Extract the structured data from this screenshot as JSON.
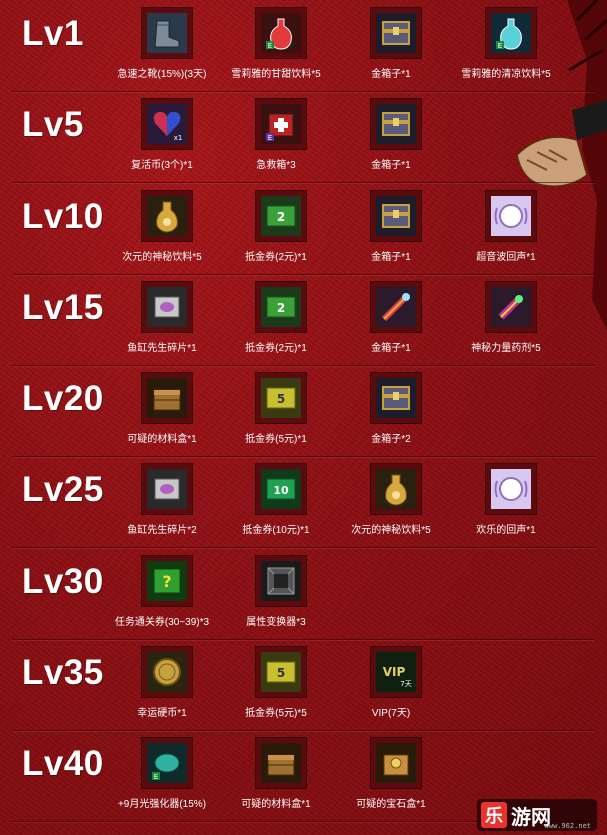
{
  "colors": {
    "background": "#8e1014",
    "icon_frame": "#5b0b0d",
    "text": "#ffffff",
    "logo_red": "#e8322c"
  },
  "rows": [
    {
      "level": "Lv1",
      "items": [
        {
          "label": "急速之靴(15%)(3天)",
          "icon": "boots-icon"
        },
        {
          "label": "雪莉雅的甘甜饮料*5",
          "icon": "red-potion-icon"
        },
        {
          "label": "金箱子*1",
          "icon": "gold-box-icon"
        },
        {
          "label": "雪莉雅的清凉饮料*5",
          "icon": "blue-potion-icon"
        }
      ]
    },
    {
      "level": "Lv5",
      "items": [
        {
          "label": "复活币(3个)*1",
          "icon": "revive-coin-icon"
        },
        {
          "label": "急救箱*3",
          "icon": "first-aid-kit-icon"
        },
        {
          "label": "金箱子*1",
          "icon": "gold-box-icon"
        }
      ]
    },
    {
      "level": "Lv10",
      "items": [
        {
          "label": "次元的神秘饮料*5",
          "icon": "mystic-drink-icon"
        },
        {
          "label": "抵金券(2元)*1",
          "icon": "coupon-2-icon"
        },
        {
          "label": "金箱子*1",
          "icon": "gold-box-icon"
        },
        {
          "label": "超音波回声*1",
          "icon": "echo-icon"
        }
      ]
    },
    {
      "level": "Lv15",
      "items": [
        {
          "label": "鱼缸先生碎片*1",
          "icon": "fish-tank-shard-icon"
        },
        {
          "label": "抵金券(2元)*1",
          "icon": "coupon-2-icon"
        },
        {
          "label": "金箱子*1",
          "icon": "crystal-wand-icon"
        },
        {
          "label": "神秘力量药剂*5",
          "icon": "power-potion-icon"
        }
      ]
    },
    {
      "level": "Lv20",
      "items": [
        {
          "label": "可疑的材料盒*1",
          "icon": "material-box-icon"
        },
        {
          "label": "抵金券(5元)*1",
          "icon": "coupon-5-icon"
        },
        {
          "label": "金箱子*2",
          "icon": "gold-box-icon"
        }
      ]
    },
    {
      "level": "Lv25",
      "items": [
        {
          "label": "鱼缸先生碎片*2",
          "icon": "fish-tank-shard-icon"
        },
        {
          "label": "抵金券(10元)*1",
          "icon": "coupon-10-icon"
        },
        {
          "label": "次元的神秘饮料*5",
          "icon": "mystic-drink-icon"
        },
        {
          "label": "欢乐的回声*1",
          "icon": "echo-icon"
        }
      ]
    },
    {
      "level": "Lv30",
      "items": [
        {
          "label": "任务通关券(30~39)*3",
          "icon": "quest-ticket-icon"
        },
        {
          "label": "属性变换器*3",
          "icon": "attribute-converter-icon"
        }
      ]
    },
    {
      "level": "Lv35",
      "items": [
        {
          "label": "幸运硬币*1",
          "icon": "lucky-coin-icon"
        },
        {
          "label": "抵金券(5元)*5",
          "icon": "coupon-5-icon"
        },
        {
          "label": "VIP(7天)",
          "icon": "vip-icon"
        }
      ]
    },
    {
      "level": "Lv40",
      "items": [
        {
          "label": "+9月光强化器(15%)",
          "icon": "enhancer-icon"
        },
        {
          "label": "可疑的材料盒*1",
          "icon": "material-box-icon"
        },
        {
          "label": "可疑的宝石盒*1",
          "icon": "gem-box-icon"
        }
      ]
    }
  ],
  "logo": {
    "mark": "乐",
    "name": "游网",
    "url": "www.962.net"
  }
}
